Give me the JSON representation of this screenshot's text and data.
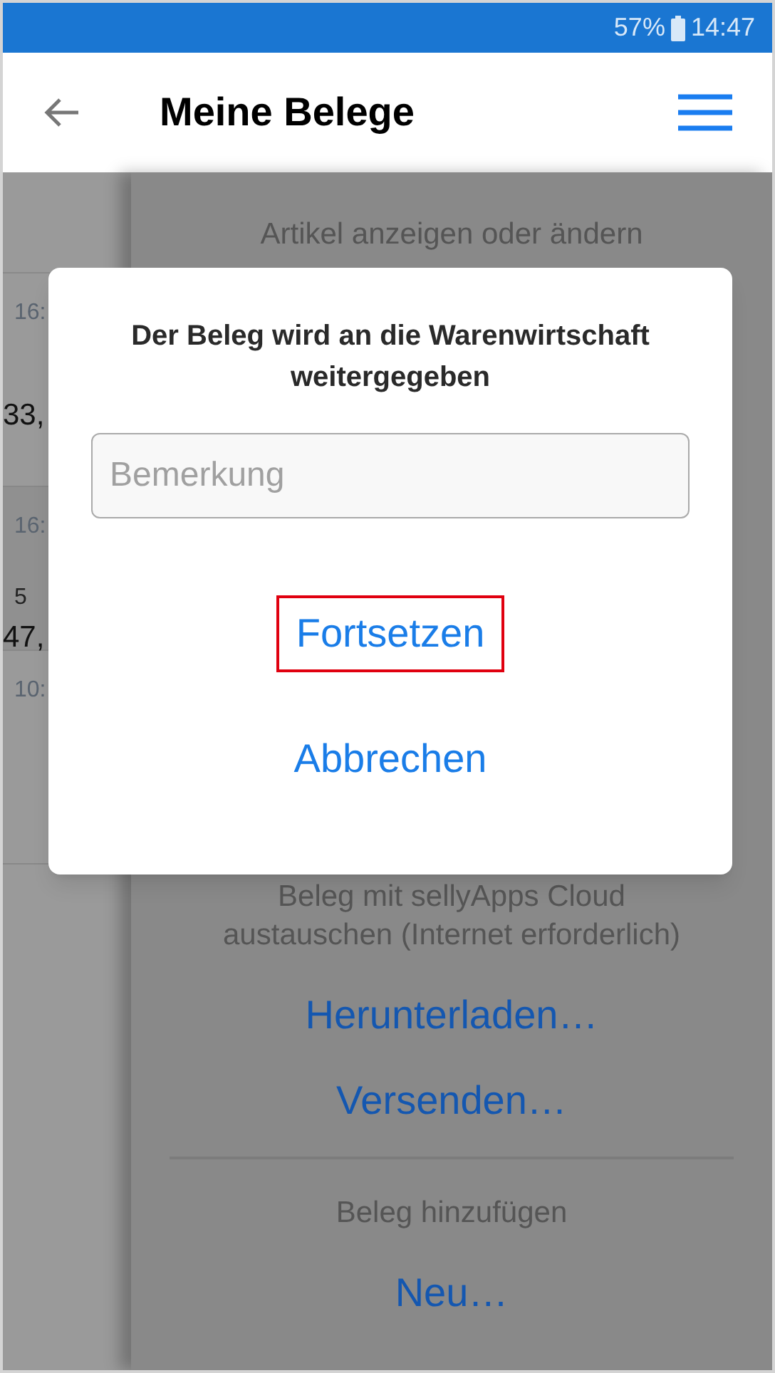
{
  "status_bar": {
    "battery": "57%",
    "time": "14:47"
  },
  "header": {
    "title": "Meine Belege"
  },
  "receipts": [
    {
      "time": "16:",
      "amount": "33,"
    },
    {
      "time": "16:",
      "note": "5",
      "amount": "47,"
    },
    {
      "time": "10:"
    }
  ],
  "side_panel": {
    "sections": [
      {
        "label": "Artikel anzeigen oder ändern"
      },
      {
        "label": "Beleg mit sellyApps Cloud austauschen (Internet erforderlich)",
        "actions": [
          "Herunterladen…",
          "Versenden…"
        ]
      },
      {
        "label": "Beleg hinzufügen",
        "actions": [
          "Neu…"
        ]
      }
    ]
  },
  "dialog": {
    "message": "Der Beleg wird an die Warenwirtschaft weitergegeben",
    "field": {
      "placeholder": "Bemerkung"
    },
    "buttons": [
      {
        "label": "Fortsetzen",
        "highlighted": true
      },
      {
        "label": "Abbrechen",
        "highlighted": false
      }
    ]
  }
}
